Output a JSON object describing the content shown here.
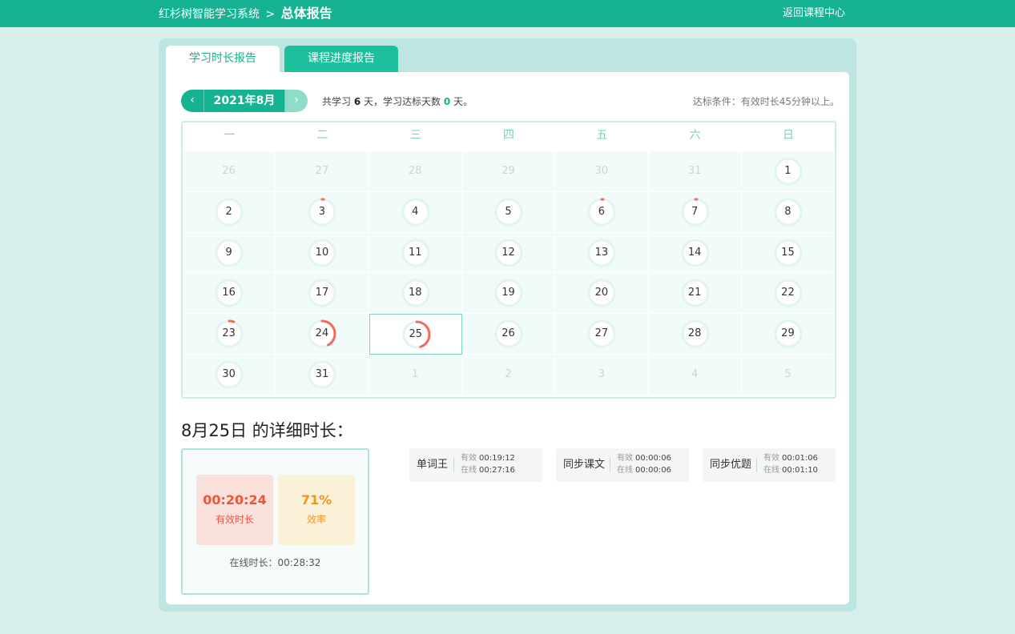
{
  "header": {
    "system_name": "红杉树智能学习系统",
    "separator": ">",
    "current_page": "总体报告",
    "back_link": "返回课程中心"
  },
  "tabs": [
    {
      "label": "学习时长报告",
      "active": true
    },
    {
      "label": "课程进度报告",
      "active": false
    }
  ],
  "month_nav": {
    "prev_glyph": "‹",
    "next_glyph": "›",
    "month_label": "2021年8月"
  },
  "summary": {
    "prefix": "共学习",
    "study_days": "6",
    "middle": "天，学习达标天数",
    "qualified_days": "0",
    "suffix": "天。"
  },
  "condition_text": "达标条件：有效时长45分钟以上。",
  "calendar": {
    "weekdays": [
      "一",
      "二",
      "三",
      "四",
      "五",
      "六",
      "日"
    ],
    "ring_colors": {
      "track": "#e1f4f0",
      "progress": "#f26b5b"
    },
    "days": [
      {
        "label": "26",
        "other": true
      },
      {
        "label": "27",
        "other": true
      },
      {
        "label": "28",
        "other": true
      },
      {
        "label": "29",
        "other": true
      },
      {
        "label": "30",
        "other": true
      },
      {
        "label": "31",
        "other": true
      },
      {
        "label": "1",
        "progress": 0
      },
      {
        "label": "2",
        "progress": 0
      },
      {
        "label": "3",
        "progress": 0.02
      },
      {
        "label": "4",
        "progress": 0
      },
      {
        "label": "5",
        "progress": 0
      },
      {
        "label": "6",
        "progress": 0.02
      },
      {
        "label": "7",
        "progress": 0.02
      },
      {
        "label": "8",
        "progress": 0
      },
      {
        "label": "9",
        "progress": 0
      },
      {
        "label": "10",
        "progress": 0
      },
      {
        "label": "11",
        "progress": 0
      },
      {
        "label": "12",
        "progress": 0
      },
      {
        "label": "13",
        "progress": 0
      },
      {
        "label": "14",
        "progress": 0
      },
      {
        "label": "15",
        "progress": 0
      },
      {
        "label": "16",
        "progress": 0
      },
      {
        "label": "17",
        "progress": 0
      },
      {
        "label": "18",
        "progress": 0
      },
      {
        "label": "19",
        "progress": 0
      },
      {
        "label": "20",
        "progress": 0
      },
      {
        "label": "21",
        "progress": 0
      },
      {
        "label": "22",
        "progress": 0
      },
      {
        "label": "23",
        "progress": 0.06
      },
      {
        "label": "24",
        "progress": 0.42
      },
      {
        "label": "25",
        "progress": 0.45,
        "selected": true
      },
      {
        "label": "26",
        "progress": 0
      },
      {
        "label": "27",
        "progress": 0
      },
      {
        "label": "28",
        "progress": 0
      },
      {
        "label": "29",
        "progress": 0
      },
      {
        "label": "30",
        "progress": 0
      },
      {
        "label": "31",
        "progress": 0
      },
      {
        "label": "1",
        "other": true
      },
      {
        "label": "2",
        "other": true
      },
      {
        "label": "3",
        "other": true
      },
      {
        "label": "4",
        "other": true
      },
      {
        "label": "5",
        "other": true
      }
    ]
  },
  "detail": {
    "title": "8月25日 的详细时长：",
    "effective_time": "00:20:24",
    "effective_label": "有效时长",
    "efficiency": "71%",
    "efficiency_label": "效率",
    "online_label": "在线时长：",
    "online_time": "00:28:32"
  },
  "modules": [
    {
      "name": "单词王",
      "effective_label": "有效",
      "effective": "00:19:12",
      "online_label": "在线",
      "online": "00:27:16"
    },
    {
      "name": "同步课文",
      "effective_label": "有效",
      "effective": "00:00:06",
      "online_label": "在线",
      "online": "00:00:06"
    },
    {
      "name": "同步优题",
      "effective_label": "有效",
      "effective": "00:01:06",
      "online_label": "在线",
      "online": "00:01:10"
    }
  ]
}
